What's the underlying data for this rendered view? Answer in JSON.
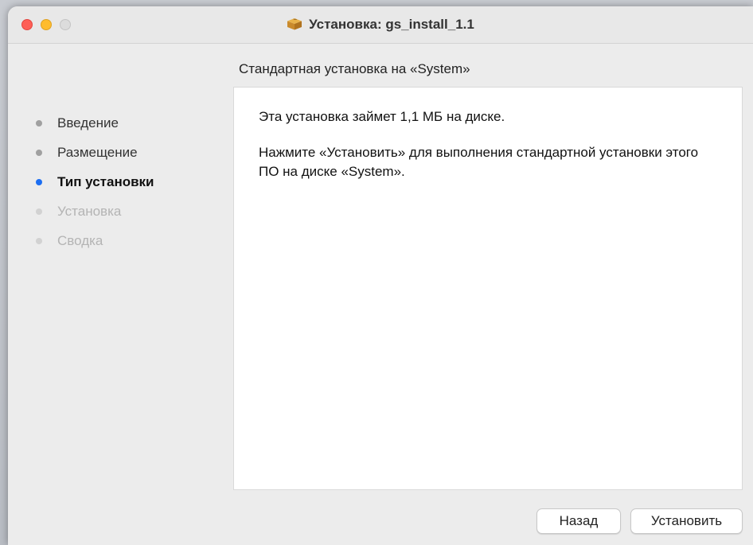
{
  "window": {
    "title": "Установка: gs_install_1.1",
    "icon": "package-icon"
  },
  "header": {
    "subtitle": "Стандартная установка на «System»"
  },
  "sidebar": {
    "steps": [
      {
        "label": "Введение",
        "state": "done"
      },
      {
        "label": "Размещение",
        "state": "done"
      },
      {
        "label": "Тип установки",
        "state": "current"
      },
      {
        "label": "Установка",
        "state": "pending"
      },
      {
        "label": "Сводка",
        "state": "pending"
      }
    ]
  },
  "content": {
    "size_text": "Эта установка займет 1,1 МБ на диске.",
    "instruction_text": "Нажмите «Установить» для выполнения стандартной установки этого ПО на диске «System»."
  },
  "buttons": {
    "back_label": "Назад",
    "install_label": "Установить"
  },
  "colors": {
    "close": "#fe5f57",
    "minimize": "#febc2e",
    "zoom": "#dcdcdc",
    "current_step": "#1c6ef2"
  }
}
